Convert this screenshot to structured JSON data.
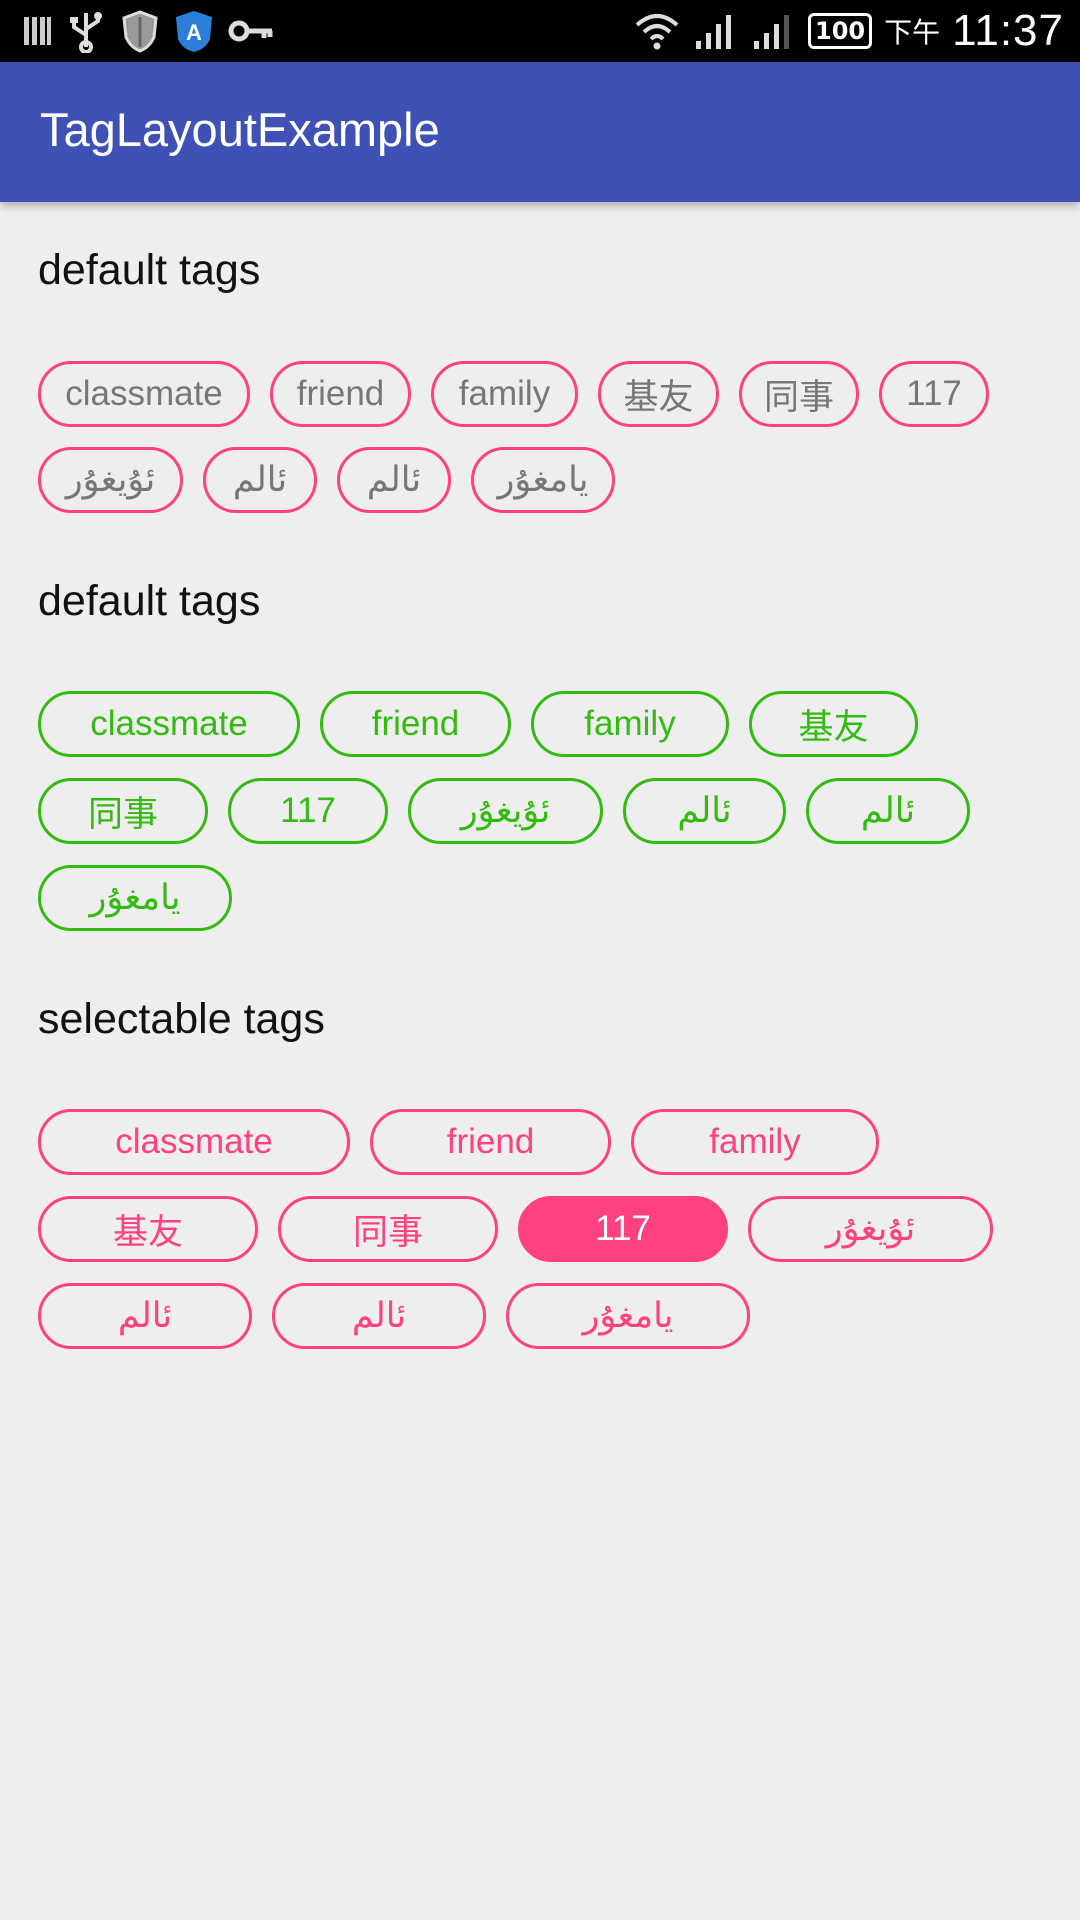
{
  "status_bar": {
    "ampm": "下午",
    "time": "11:37",
    "battery": "100",
    "icons": [
      "bars-icon",
      "usb-icon",
      "shield-icon",
      "vpn-badge-icon",
      "key-icon",
      "wifi-icon",
      "signal-icon",
      "signal-icon"
    ],
    "vpn_letter": "A"
  },
  "app_bar": {
    "title": "TagLayoutExample"
  },
  "sections": [
    {
      "title": "default tags",
      "style": "gray",
      "tags": [
        "classmate",
        "friend",
        "family",
        "基友",
        "同事",
        "117",
        "ئۇيغۇر",
        "ئالم",
        "ئالم",
        "يامغۇر"
      ]
    },
    {
      "title": "default tags",
      "style": "green",
      "tags": [
        "classmate",
        "friend",
        "family",
        "基友",
        "同事",
        "117",
        "ئۇيغۇر",
        "ئالم",
        "ئالم",
        "يامغۇر"
      ]
    },
    {
      "title": "selectable tags",
      "style": "pink",
      "selected_tag": "117",
      "tags": [
        "classmate",
        "friend",
        "family",
        "基友",
        "同事",
        "117",
        "ئۇيغۇر",
        "ئالم",
        "ئالم",
        "يامغۇر"
      ]
    }
  ],
  "colors": {
    "app_bar": "#3f51b5",
    "accent_pink": "#ff4081",
    "green": "#33bb11",
    "gray_text": "#777777",
    "background": "#eeeeee"
  }
}
